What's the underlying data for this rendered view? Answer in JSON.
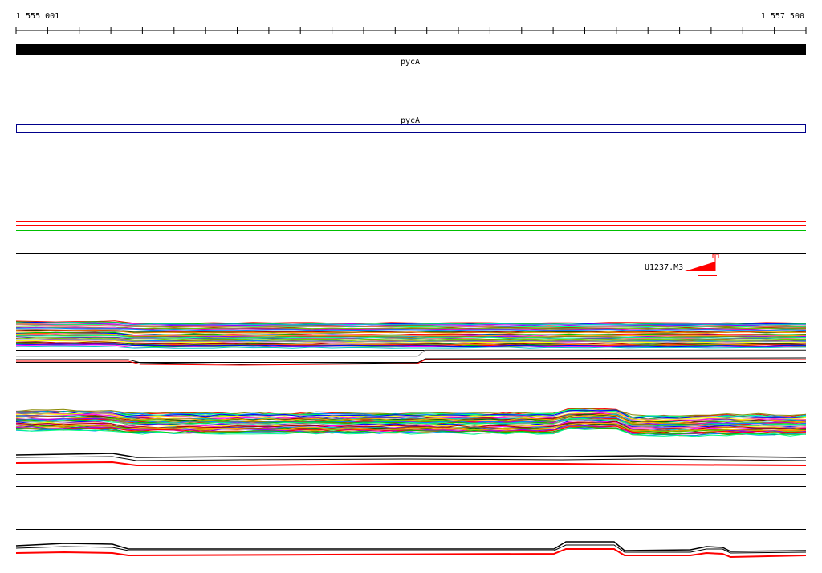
{
  "ruler": {
    "start_label": "1 555 001",
    "end_label": "1 557 500"
  },
  "gene_track": {
    "label": "pycA"
  },
  "cds_track": {
    "label": "pycA",
    "outline_color": "#00008b"
  },
  "feature": {
    "label": "U1237.M3",
    "color": "#ff0000"
  },
  "colors": {
    "gene_bar": "#000000",
    "reference_red": "#ff0000",
    "reference_green": "#00c000"
  }
}
